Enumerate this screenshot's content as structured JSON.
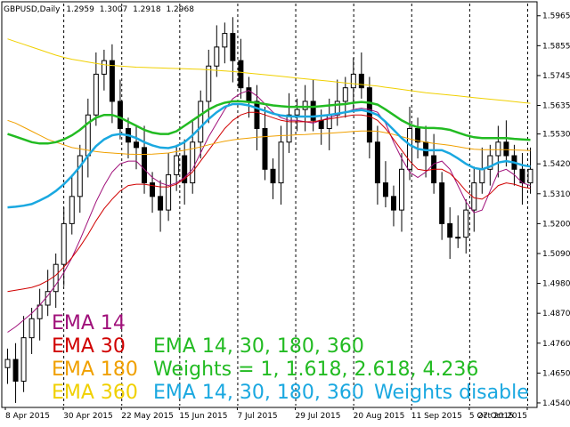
{
  "header": {
    "symbol": "GBPUSD,Daily",
    "open": "1.2959",
    "high": "1.3007",
    "low": "1.2918",
    "close": "1.2968"
  },
  "chart_data": {
    "type": "candlestick",
    "ylim": [
      1.453,
      1.601
    ],
    "y_ticks": [
      "1.5965",
      "1.5855",
      "1.5745",
      "1.5635",
      "1.5530",
      "1.5420",
      "1.5310",
      "1.5200",
      "1.5090",
      "1.4980",
      "1.4870",
      "1.4760",
      "1.4650",
      "1.4540"
    ],
    "x_ticks": [
      "8 Apr 2015",
      "30 Apr 2015",
      "22 May 2015",
      "15 Jun 2015",
      "7 Jul 2015",
      "29 Jul 2015",
      "20 Aug 2015",
      "11 Sep 2015",
      "5 Oct 2015",
      "27 Oct 2015"
    ],
    "grid": "vertical-dashed",
    "series": [
      {
        "name": "EMA 14",
        "color": "#a0107a",
        "values": [
          1.48,
          1.482,
          1.4845,
          1.487,
          1.49,
          1.4935,
          1.4975,
          1.502,
          1.5075,
          1.514,
          1.521,
          1.528,
          1.534,
          1.539,
          1.542,
          1.543,
          1.543,
          1.54,
          1.537,
          1.535,
          1.534,
          1.535,
          1.537,
          1.54,
          1.546,
          1.552,
          1.557,
          1.562,
          1.566,
          1.568,
          1.569,
          1.567,
          1.564,
          1.561,
          1.559,
          1.558,
          1.558,
          1.5575,
          1.557,
          1.558,
          1.559,
          1.56,
          1.561,
          1.562,
          1.5625,
          1.562,
          1.561,
          1.557,
          1.55,
          1.544,
          1.539,
          1.537,
          1.539,
          1.542,
          1.543,
          1.54,
          1.534,
          1.528,
          1.524,
          1.525,
          1.532,
          1.539,
          1.54,
          1.538,
          1.535,
          1.534
        ]
      },
      {
        "name": "EMA 30",
        "color": "#d00000",
        "values": [
          1.495,
          1.4955,
          1.496,
          1.4965,
          1.4975,
          1.499,
          1.501,
          1.504,
          1.5075,
          1.5115,
          1.516,
          1.521,
          1.5255,
          1.529,
          1.532,
          1.534,
          1.5345,
          1.5345,
          1.534,
          1.5335,
          1.5335,
          1.5345,
          1.5365,
          1.539,
          1.543,
          1.547,
          1.551,
          1.555,
          1.558,
          1.56,
          1.561,
          1.561,
          1.56,
          1.559,
          1.558,
          1.5575,
          1.5575,
          1.5575,
          1.5575,
          1.558,
          1.5585,
          1.559,
          1.5595,
          1.56,
          1.56,
          1.5595,
          1.558,
          1.555,
          1.551,
          1.547,
          1.543,
          1.54,
          1.5395,
          1.54,
          1.54,
          1.5385,
          1.5355,
          1.532,
          1.5295,
          1.529,
          1.531,
          1.534,
          1.535,
          1.5345,
          1.5335,
          1.533
        ]
      },
      {
        "name": "EMA 180",
        "color": "#f0a000",
        "values": [
          1.558,
          1.557,
          1.5555,
          1.554,
          1.5525,
          1.551,
          1.55,
          1.549,
          1.548,
          1.5475,
          1.547,
          1.5465,
          1.5462,
          1.546,
          1.5458,
          1.5456,
          1.5455,
          1.5455,
          1.5456,
          1.5458,
          1.546,
          1.5465,
          1.547,
          1.5476,
          1.5482,
          1.549,
          1.5497,
          1.5503,
          1.5508,
          1.5512,
          1.5515,
          1.5518,
          1.552,
          1.5522,
          1.5524,
          1.5525,
          1.5527,
          1.5528,
          1.553,
          1.5531,
          1.5533,
          1.5535,
          1.5537,
          1.5539,
          1.5541,
          1.5541,
          1.554,
          1.5535,
          1.5528,
          1.552,
          1.5512,
          1.5505,
          1.55,
          1.5495,
          1.5492,
          1.5488,
          1.5483,
          1.5478,
          1.5474,
          1.5472,
          1.5472,
          1.5472,
          1.5472,
          1.5471,
          1.547,
          1.5469
        ]
      },
      {
        "name": "EMA 360",
        "color": "#f0d000",
        "values": [
          1.588,
          1.587,
          1.586,
          1.585,
          1.584,
          1.583,
          1.582,
          1.5812,
          1.5805,
          1.58,
          1.5795,
          1.579,
          1.5785,
          1.5782,
          1.578,
          1.5778,
          1.5776,
          1.5775,
          1.5774,
          1.5773,
          1.5772,
          1.5771,
          1.577,
          1.5769,
          1.5768,
          1.5766,
          1.5764,
          1.5762,
          1.576,
          1.5757,
          1.5754,
          1.5751,
          1.5748,
          1.5745,
          1.5742,
          1.5739,
          1.5736,
          1.5733,
          1.573,
          1.5727,
          1.5724,
          1.5721,
          1.5718,
          1.5715,
          1.5712,
          1.5709,
          1.5706,
          1.5702,
          1.5698,
          1.5694,
          1.569,
          1.5686,
          1.5682,
          1.5679,
          1.5676,
          1.5673,
          1.567,
          1.5667,
          1.5664,
          1.5661,
          1.5658,
          1.5655,
          1.5652,
          1.5649,
          1.5646,
          1.5643
        ]
      },
      {
        "name": "EMA 14, 30, 180, 360 Weights = 1, 1.618, 2.618, 4.236",
        "color": "#22bb22",
        "values": [
          1.553,
          1.552,
          1.551,
          1.55,
          1.5495,
          1.5495,
          1.55,
          1.551,
          1.5525,
          1.5545,
          1.557,
          1.559,
          1.56,
          1.56,
          1.559,
          1.5575,
          1.556,
          1.5545,
          1.5535,
          1.553,
          1.553,
          1.554,
          1.556,
          1.558,
          1.56,
          1.562,
          1.5635,
          1.5645,
          1.565,
          1.565,
          1.5648,
          1.5645,
          1.564,
          1.5635,
          1.5632,
          1.563,
          1.563,
          1.563,
          1.563,
          1.5632,
          1.5635,
          1.5638,
          1.564,
          1.5645,
          1.5648,
          1.5645,
          1.5638,
          1.562,
          1.56,
          1.558,
          1.5565,
          1.5555,
          1.5552,
          1.5552,
          1.555,
          1.5545,
          1.5535,
          1.5525,
          1.5518,
          1.5515,
          1.5515,
          1.5515,
          1.5515,
          1.5512,
          1.551,
          1.5508
        ]
      },
      {
        "name": "EMA 14, 30, 180, 360 Weights disable",
        "color": "#1aa8e0",
        "values": [
          1.526,
          1.5262,
          1.5266,
          1.5272,
          1.5285,
          1.53,
          1.532,
          1.5345,
          1.5375,
          1.541,
          1.545,
          1.5485,
          1.551,
          1.5525,
          1.553,
          1.5525,
          1.5515,
          1.55,
          1.5488,
          1.548,
          1.5478,
          1.5485,
          1.55,
          1.5525,
          1.5555,
          1.5585,
          1.561,
          1.563,
          1.564,
          1.564,
          1.5635,
          1.5625,
          1.5615,
          1.5605,
          1.5598,
          1.5595,
          1.5594,
          1.5594,
          1.5594,
          1.5597,
          1.56,
          1.5605,
          1.561,
          1.5615,
          1.5618,
          1.5612,
          1.56,
          1.5575,
          1.5545,
          1.5515,
          1.549,
          1.5475,
          1.547,
          1.547,
          1.547,
          1.5458,
          1.544,
          1.542,
          1.5405,
          1.54,
          1.541,
          1.5425,
          1.543,
          1.5425,
          1.5415,
          1.541
        ]
      }
    ],
    "candles_close": [
      1.47,
      1.462,
      1.478,
      1.485,
      1.49,
      1.495,
      1.505,
      1.52,
      1.53,
      1.545,
      1.56,
      1.575,
      1.58,
      1.565,
      1.555,
      1.55,
      1.548,
      1.535,
      1.53,
      1.525,
      1.538,
      1.545,
      1.535,
      1.55,
      1.565,
      1.578,
      1.585,
      1.59,
      1.58,
      1.57,
      1.565,
      1.555,
      1.54,
      1.535,
      1.55,
      1.56,
      1.562,
      1.565,
      1.558,
      1.555,
      1.56,
      1.565,
      1.57,
      1.575,
      1.57,
      1.55,
      1.535,
      1.53,
      1.525,
      1.54,
      1.555,
      1.55,
      1.545,
      1.535,
      1.52,
      1.515,
      1.515,
      1.525,
      1.535,
      1.54,
      1.545,
      1.55,
      1.545,
      1.54,
      1.535,
      1.54
    ]
  },
  "legend": {
    "ema14": "EMA 14",
    "ema30": "EMA 30",
    "ema180": "EMA 180",
    "ema360": "EMA 360",
    "combo_weighted_line1": "EMA 14, 30, 180, 360",
    "combo_weighted_line2": "Weights = 1, 1.618, 2.618, 4.236",
    "combo_plain": "EMA 14, 30, 180, 360",
    "weights_disable": "Weights disable"
  },
  "colors": {
    "ema14": "#a0107a",
    "ema30": "#d00000",
    "ema180": "#f0a000",
    "ema360": "#f0d000",
    "weighted": "#22bb22",
    "plain": "#1aa8e0",
    "candle_up": "#ffffff",
    "candle_down": "#000000",
    "grid": "#000000"
  }
}
